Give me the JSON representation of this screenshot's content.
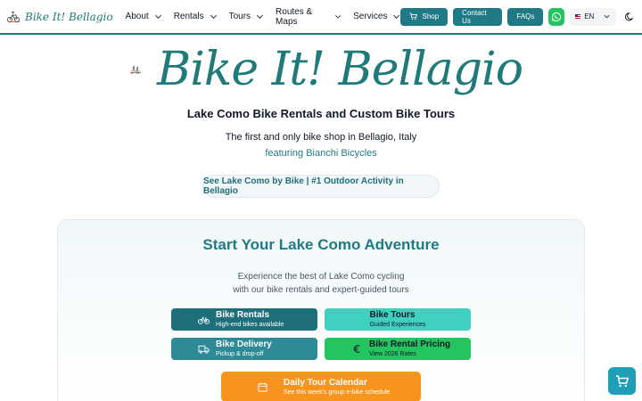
{
  "nav": {
    "brand": "Bike It! Bellagio",
    "menu": [
      {
        "label": "About"
      },
      {
        "label": "Rentals"
      },
      {
        "label": "Tours"
      },
      {
        "label": "Routes & Maps"
      },
      {
        "label": "Services"
      }
    ],
    "buttons": {
      "shop": "Shop",
      "contact": "Contact Us",
      "faqs": "FAQs"
    },
    "language": "EN"
  },
  "hero": {
    "logo_text": "Bike It! Bellagio",
    "subtitle": "Lake Como Bike Rentals and Custom Bike Tours",
    "tagline": "The first and only bike shop in Bellagio, Italy",
    "featuring": "featuring Bianchi Bicycles",
    "banner": "See Lake Como by Bike | #1 Outdoor Activity in Bellagio"
  },
  "adventure": {
    "title": "Start Your Lake Como Adventure",
    "desc_line1": "Experience the best of Lake Como cycling",
    "desc_line2": "with our bike rentals and expert-guided tours",
    "tiles": {
      "rentals": {
        "title": "Bike Rentals",
        "sub": "High-end bikes available"
      },
      "tours": {
        "title": "Bike Tours",
        "sub": "Guided Experiences"
      },
      "delivery": {
        "title": "Bike Delivery",
        "sub": "Pickup & drop-off"
      },
      "pricing": {
        "title": "Bike Rental Pricing",
        "sub": "View 2026 Rates"
      },
      "calendar": {
        "title": "Daily Tour Calendar",
        "sub": "See this week's group e-bike schedule"
      }
    }
  },
  "icons": {
    "brand": "cyclists-logo-icon",
    "shop": "cart-icon",
    "whatsapp": "whatsapp-icon",
    "theme": "moon-icon",
    "rentals": "bicycle-icon",
    "delivery": "truck-icon",
    "pricing": "euro-icon",
    "calendar": "calendar-icon",
    "cart": "cart-icon"
  },
  "colors": {
    "brand_teal": "#1f7a7a",
    "button_teal": "#1f7a85",
    "tours_mint": "#3fd0bf",
    "pricing_green": "#22c55e",
    "calendar_orange": "#f7941d",
    "cart_cyan": "#1f9fb5"
  }
}
